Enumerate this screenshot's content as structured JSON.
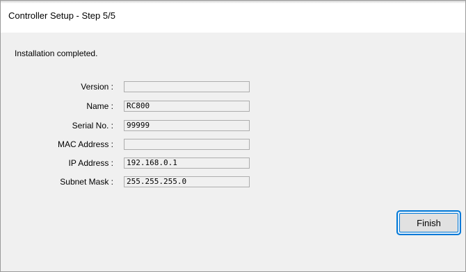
{
  "window": {
    "title": "Controller Setup - Step 5/5"
  },
  "status": {
    "message": "Installation completed."
  },
  "fields": [
    {
      "label": "Version :",
      "value": ""
    },
    {
      "label": "Name :",
      "value": "RC800"
    },
    {
      "label": "Serial No. :",
      "value": "99999"
    },
    {
      "label": "MAC Address :",
      "value": ""
    },
    {
      "label": "IP Address :",
      "value": "192.168.0.1"
    },
    {
      "label": "Subnet Mask :",
      "value": "255.255.255.0"
    }
  ],
  "buttons": {
    "finish_label": "Finish"
  },
  "colors": {
    "focus_accent": "#0078d7",
    "dialog_background": "#f0f0f0"
  }
}
